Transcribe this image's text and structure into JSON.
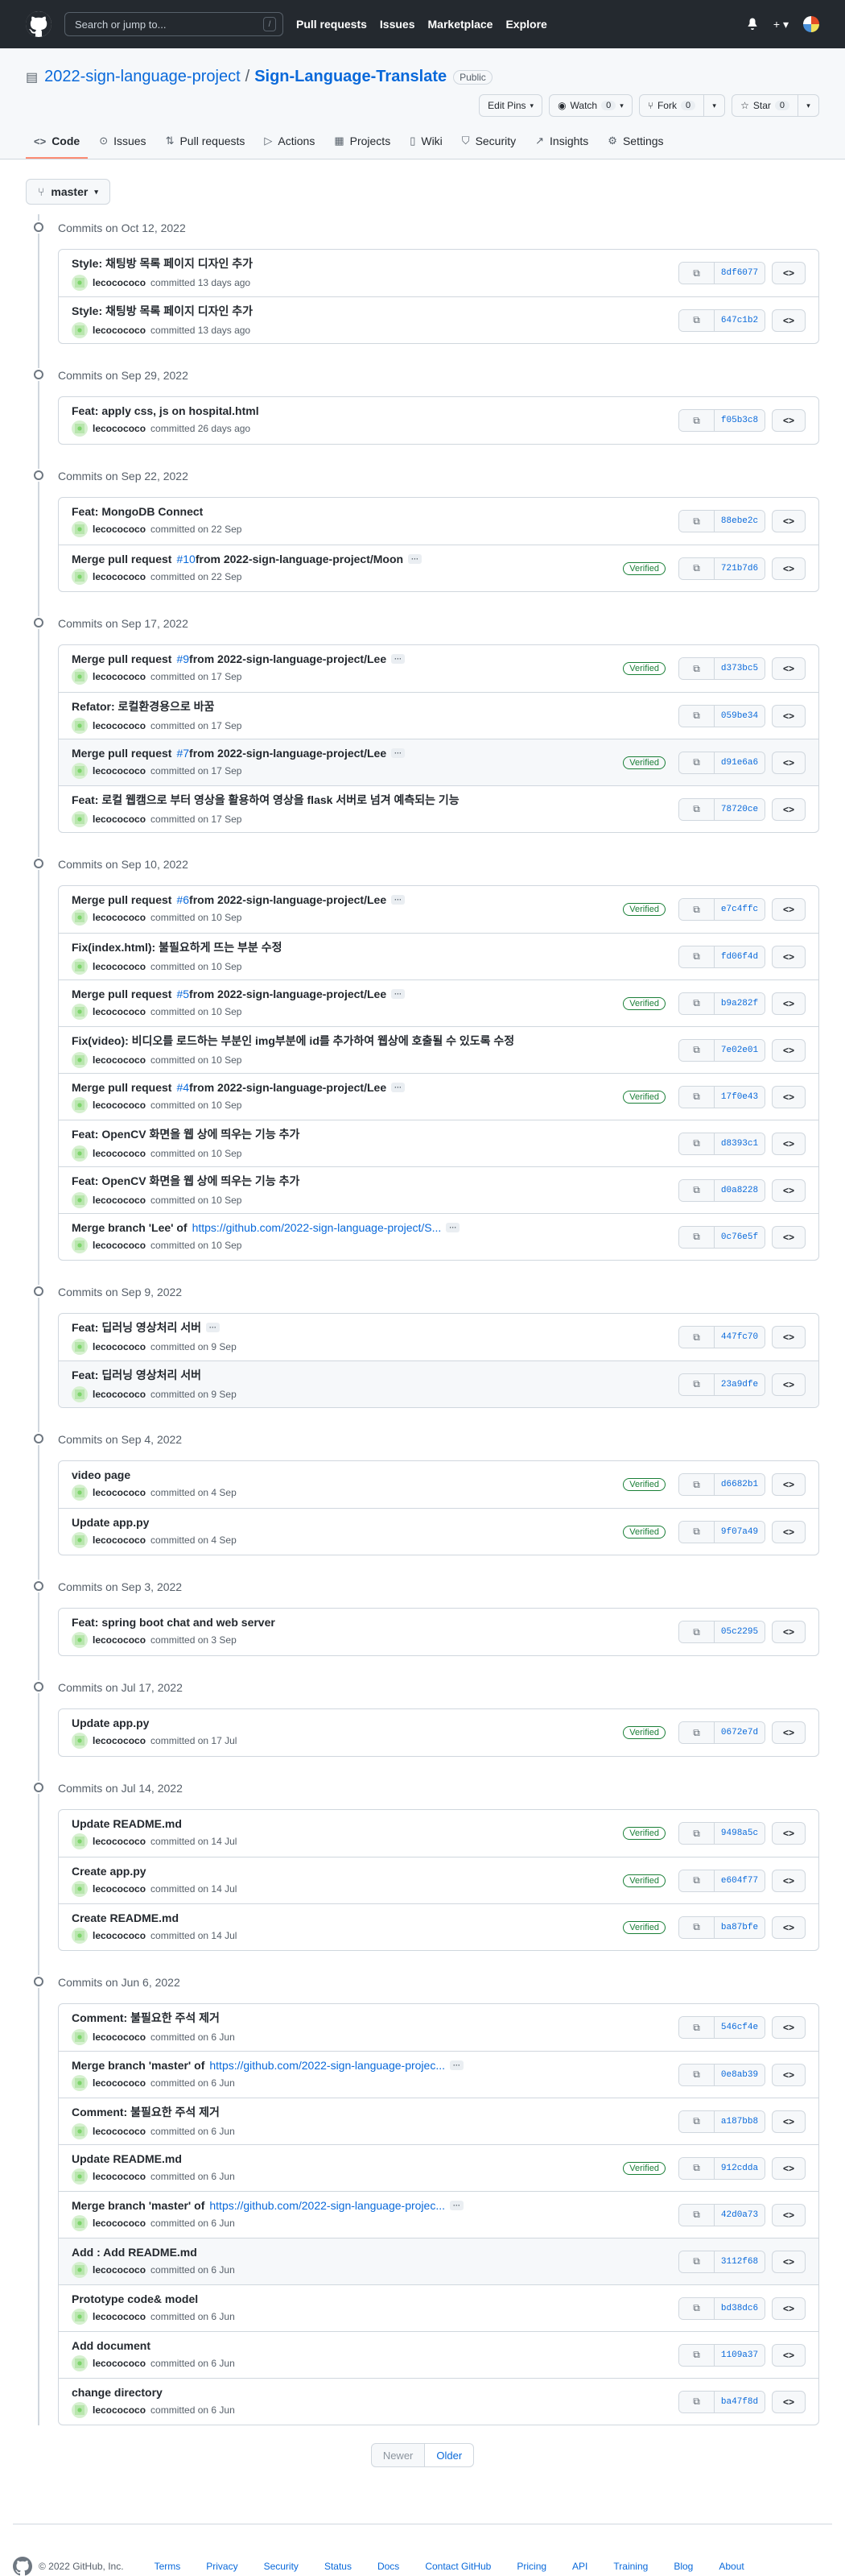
{
  "header": {
    "search_placeholder": "Search or jump to...",
    "slash": "/",
    "nav": [
      "Pull requests",
      "Issues",
      "Marketplace",
      "Explore"
    ],
    "plus": "+ ▾"
  },
  "repo": {
    "owner": "2022-sign-language-project",
    "sep": "/",
    "name": "Sign-Language-Translate",
    "visibility": "Public",
    "actions": {
      "pins": "Edit Pins",
      "watch": "Watch",
      "watch_count": "0",
      "fork": "Fork",
      "fork_count": "0",
      "star": "Star",
      "star_count": "0"
    }
  },
  "tabs": [
    {
      "label": "Code",
      "icon": "<>"
    },
    {
      "label": "Issues",
      "icon": "⊙"
    },
    {
      "label": "Pull requests",
      "icon": "⇅"
    },
    {
      "label": "Actions",
      "icon": "▷"
    },
    {
      "label": "Projects",
      "icon": "▦"
    },
    {
      "label": "Wiki",
      "icon": "▯"
    },
    {
      "label": "Security",
      "icon": "⛉"
    },
    {
      "label": "Insights",
      "icon": "↗"
    },
    {
      "label": "Settings",
      "icon": "⚙"
    }
  ],
  "branch": "master",
  "groups": [
    {
      "title": "Commits on Oct 12, 2022",
      "commits": [
        {
          "pre": "Style: 채팅방 목록 페이지 디자인 추가",
          "user": "lecocococo",
          "time": "committed 13 days ago",
          "sha": "8df6077",
          "verified": false
        },
        {
          "pre": "Style: 채팅방 목록 페이지 디자인 추가",
          "user": "lecocococo",
          "time": "committed 13 days ago",
          "sha": "647c1b2",
          "verified": false
        }
      ]
    },
    {
      "title": "Commits on Sep 29, 2022",
      "commits": [
        {
          "pre": "Feat: apply css, js on hospital.html",
          "user": "lecocococo",
          "time": "committed 26 days ago",
          "sha": "f05b3c8",
          "verified": false
        }
      ]
    },
    {
      "title": "Commits on Sep 22, 2022",
      "commits": [
        {
          "pre": "Feat: MongoDB Connect",
          "user": "lecocococo",
          "time": "committed on 22 Sep",
          "sha": "88ebe2c",
          "verified": false
        },
        {
          "pre": "Merge pull request ",
          "link": "#10",
          "post": " from 2022-sign-language-project/Moon",
          "more": true,
          "user": "lecocococo",
          "time": "committed on 22 Sep",
          "sha": "721b7d6",
          "verified": true
        }
      ]
    },
    {
      "title": "Commits on Sep 17, 2022",
      "commits": [
        {
          "pre": "Merge pull request ",
          "link": "#9",
          "post": " from 2022-sign-language-project/Lee",
          "more": true,
          "user": "lecocococo",
          "time": "committed on 17 Sep",
          "sha": "d373bc5",
          "verified": true
        },
        {
          "pre": "Refator: 로컬환경용으로 바꿈",
          "user": "lecocococo",
          "time": "committed on 17 Sep",
          "sha": "059be34",
          "verified": false
        },
        {
          "pre": "Merge pull request ",
          "link": "#7",
          "post": " from 2022-sign-language-project/Lee",
          "more": true,
          "user": "lecocococo",
          "time": "committed on 17 Sep",
          "sha": "d91e6a6",
          "verified": true,
          "hl": true
        },
        {
          "pre": "Feat: 로컬 웹캠으로 부터 영상을 활용하여 영상을 flask 서버로 넘겨 예측되는 기능",
          "user": "lecocococo",
          "time": "committed on 17 Sep",
          "sha": "78720ce",
          "verified": false
        }
      ]
    },
    {
      "title": "Commits on Sep 10, 2022",
      "commits": [
        {
          "pre": "Merge pull request ",
          "link": "#6",
          "post": " from 2022-sign-language-project/Lee",
          "more": true,
          "user": "lecocococo",
          "time": "committed on 10 Sep",
          "sha": "e7c4ffc",
          "verified": true
        },
        {
          "pre": "Fix(index.html): 불필요하게 뜨는 부분 수정",
          "user": "lecocococo",
          "time": "committed on 10 Sep",
          "sha": "fd06f4d",
          "verified": false
        },
        {
          "pre": "Merge pull request ",
          "link": "#5",
          "post": " from 2022-sign-language-project/Lee",
          "more": true,
          "user": "lecocococo",
          "time": "committed on 10 Sep",
          "sha": "b9a282f",
          "verified": true
        },
        {
          "pre": "Fix(video): 비디오를 로드하는 부분인 img부분에 id를 추가하여 웹상에 호출될 수 있도록 수정",
          "user": "lecocococo",
          "time": "committed on 10 Sep",
          "sha": "7e02e01",
          "verified": false
        },
        {
          "pre": "Merge pull request ",
          "link": "#4",
          "post": " from 2022-sign-language-project/Lee",
          "more": true,
          "user": "lecocococo",
          "time": "committed on 10 Sep",
          "sha": "17f0e43",
          "verified": true
        },
        {
          "pre": "Feat: OpenCV 화면을 웹 상에 띄우는 기능 추가",
          "user": "lecocococo",
          "time": "committed on 10 Sep",
          "sha": "d8393c1",
          "verified": false
        },
        {
          "pre": "Feat: OpenCV 화면을 웹 상에 띄우는 기능 추가",
          "user": "lecocococo",
          "time": "committed on 10 Sep",
          "sha": "d0a8228",
          "verified": false
        },
        {
          "pre": "Merge branch 'Lee' of ",
          "link": "https://github.com/2022-sign-language-project/S...",
          "post": "",
          "more": true,
          "user": "lecocococo",
          "time": "committed on 10 Sep",
          "sha": "0c76e5f",
          "verified": false
        }
      ]
    },
    {
      "title": "Commits on Sep 9, 2022",
      "commits": [
        {
          "pre": "Feat: 딥러닝 영상처리 서버",
          "more": true,
          "user": "lecocococo",
          "time": "committed on 9 Sep",
          "sha": "447fc70",
          "verified": false
        },
        {
          "pre": "Feat: 딥러닝 영상처리 서버",
          "user": "lecocococo",
          "time": "committed on 9 Sep",
          "sha": "23a9dfe",
          "verified": false,
          "hl": true
        }
      ]
    },
    {
      "title": "Commits on Sep 4, 2022",
      "commits": [
        {
          "pre": "video page",
          "user": "lecocococo",
          "time": "committed on 4 Sep",
          "sha": "d6682b1",
          "verified": true
        },
        {
          "pre": "Update app.py",
          "user": "lecocococo",
          "time": "committed on 4 Sep",
          "sha": "9f07a49",
          "verified": true
        }
      ]
    },
    {
      "title": "Commits on Sep 3, 2022",
      "commits": [
        {
          "pre": "Feat: spring boot chat and web server",
          "user": "lecocococo",
          "time": "committed on 3 Sep",
          "sha": "05c2295",
          "verified": false
        }
      ]
    },
    {
      "title": "Commits on Jul 17, 2022",
      "commits": [
        {
          "pre": "Update app.py",
          "user": "lecocococo",
          "time": "committed on 17 Jul",
          "sha": "0672e7d",
          "verified": true
        }
      ]
    },
    {
      "title": "Commits on Jul 14, 2022",
      "commits": [
        {
          "pre": "Update README.md",
          "user": "lecocococo",
          "time": "committed on 14 Jul",
          "sha": "9498a5c",
          "verified": true
        },
        {
          "pre": "Create app.py",
          "user": "lecocococo",
          "time": "committed on 14 Jul",
          "sha": "e604f77",
          "verified": true
        },
        {
          "pre": "Create README.md",
          "user": "lecocococo",
          "time": "committed on 14 Jul",
          "sha": "ba87bfe",
          "verified": true
        }
      ]
    },
    {
      "title": "Commits on Jun 6, 2022",
      "commits": [
        {
          "pre": "Comment: 불필요한 주석 제거",
          "user": "lecocococo",
          "time": "committed on 6 Jun",
          "sha": "546cf4e",
          "verified": false
        },
        {
          "pre": "Merge branch 'master' of ",
          "link": "https://github.com/2022-sign-language-projec...",
          "post": "",
          "more": true,
          "user": "lecocococo",
          "time": "committed on 6 Jun",
          "sha": "0e8ab39",
          "verified": false
        },
        {
          "pre": "Comment: 불필요한 주석 제거",
          "user": "lecocococo",
          "time": "committed on 6 Jun",
          "sha": "a187bb8",
          "verified": false
        },
        {
          "pre": "Update README.md",
          "user": "lecocococo",
          "time": "committed on 6 Jun",
          "sha": "912cdda",
          "verified": true
        },
        {
          "pre": "Merge branch 'master' of ",
          "link": "https://github.com/2022-sign-language-projec...",
          "post": "",
          "more": true,
          "user": "lecocococo",
          "time": "committed on 6 Jun",
          "sha": "42d0a73",
          "verified": false
        },
        {
          "pre": "Add : Add README.md",
          "user": "lecocococo",
          "time": "committed on 6 Jun",
          "sha": "3112f68",
          "verified": false,
          "hl": true
        },
        {
          "pre": "Prototype code& model",
          "user": "lecocococo",
          "time": "committed on 6 Jun",
          "sha": "bd38dc6",
          "verified": false
        },
        {
          "pre": "Add document",
          "user": "lecocococo",
          "time": "committed on 6 Jun",
          "sha": "1109a37",
          "verified": false
        },
        {
          "pre": "change directory",
          "user": "lecocococo",
          "time": "committed on 6 Jun",
          "sha": "ba47f8d",
          "verified": false
        }
      ]
    }
  ],
  "labels": {
    "verified": "Verified",
    "more": "···",
    "copy": "⧉",
    "browse": "<>"
  },
  "pager": {
    "newer": "Newer",
    "older": "Older"
  },
  "footer": {
    "copyright": "© 2022 GitHub, Inc.",
    "links": [
      "Terms",
      "Privacy",
      "Security",
      "Status",
      "Docs",
      "Contact GitHub",
      "Pricing",
      "API",
      "Training",
      "Blog",
      "About"
    ]
  },
  "colors": {
    "header_bg": "#24292f",
    "link": "#0969da",
    "verified": "#1a7f37",
    "active_tab": "#fd8c73"
  }
}
